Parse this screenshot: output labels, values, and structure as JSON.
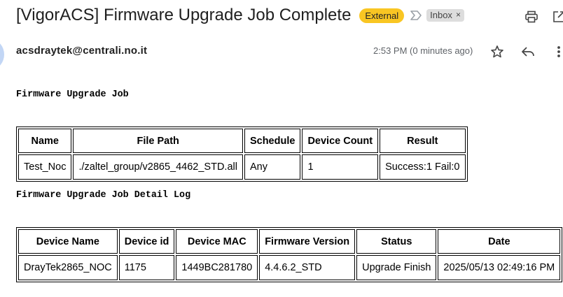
{
  "subject": "[VigorACS] Firmware Upgrade Job Complete",
  "labels": {
    "external": "External",
    "inbox": "Inbox",
    "inbox_remove": "×"
  },
  "sender": "acsdraytek@centrali.no.it",
  "timestamp": "2:53 PM (0 minutes ago)",
  "icons": [
    "importance-marker-icon",
    "print-icon",
    "open-in-new-window-icon",
    "star-icon",
    "reply-icon",
    "more-vert-icon"
  ],
  "colors": {
    "external_badge": "#f9c623",
    "inbox_badge": "#dddddd",
    "avatar": "#c2d6f5"
  },
  "section1": {
    "title": "Firmware Upgrade Job",
    "headers": [
      "Name",
      "File Path",
      "Schedule",
      "Device Count",
      "Result"
    ],
    "rows": [
      [
        "Test_Noc",
        "./zaltel_group/v2865_4462_STD.all",
        "Any",
        "1",
        "Success:1 Fail:0"
      ]
    ]
  },
  "section2": {
    "title": "Firmware Upgrade Job Detail Log",
    "headers": [
      "Device Name",
      "Device id",
      "Device MAC",
      "Firmware Version",
      "Status",
      "Date"
    ],
    "rows": [
      [
        "DrayTek2865_NOC",
        "1175",
        "1449BC281780",
        "4.4.6.2_STD",
        "Upgrade Finish",
        "2025/05/13 02:49:16 PM"
      ]
    ]
  }
}
